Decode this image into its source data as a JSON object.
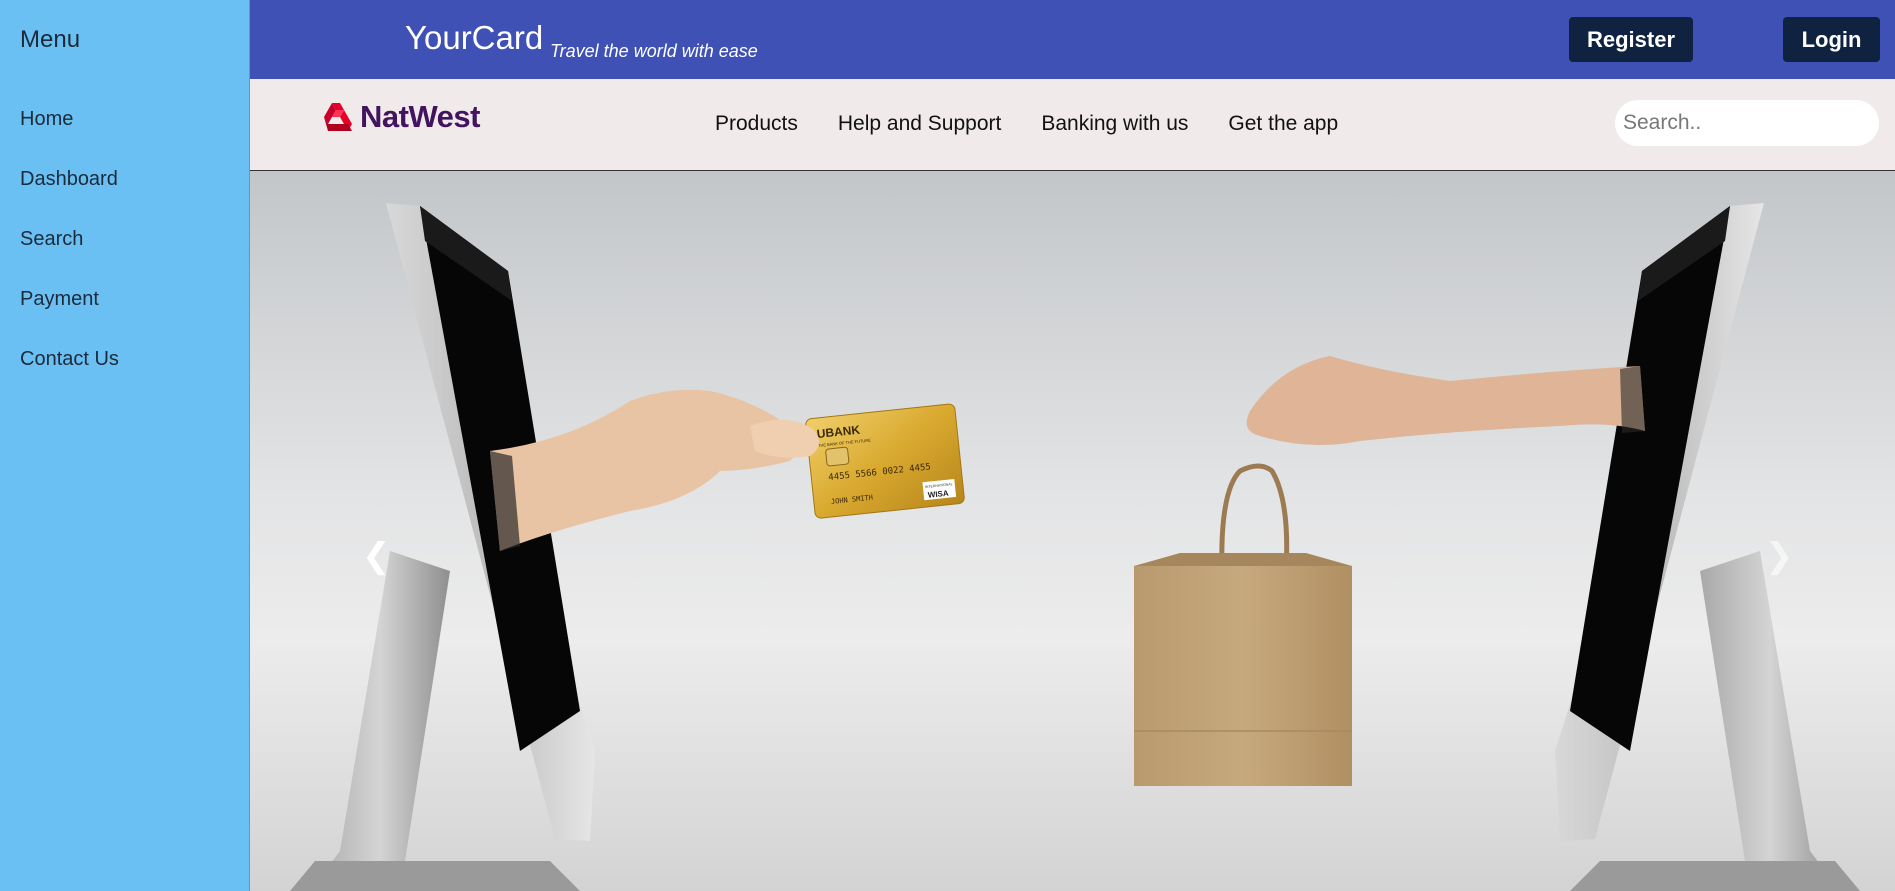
{
  "sidebar": {
    "title": "Menu",
    "items": [
      {
        "label": "Home"
      },
      {
        "label": "Dashboard"
      },
      {
        "label": "Search"
      },
      {
        "label": "Payment"
      },
      {
        "label": "Contact Us"
      }
    ]
  },
  "header": {
    "brand": "YourCard",
    "tagline": "Travel the world with ease",
    "register_label": "Register",
    "login_label": "Login"
  },
  "nav": {
    "logo_text": "NatWest",
    "links": [
      {
        "label": "Products"
      },
      {
        "label": "Help and Support"
      },
      {
        "label": "Banking with us"
      },
      {
        "label": "Get the app"
      }
    ],
    "search_placeholder": "Search.."
  },
  "hero": {
    "card_bank": "UBANK",
    "card_tagline": "THE BANK OF THE FUTURE",
    "card_number": "4455 5566 0022 4455",
    "card_holder": "JOHN SMITH",
    "card_network": "WISA",
    "card_network_label": "INTERNATIONAL",
    "prev_icon": "chevron-left-icon",
    "next_icon": "chevron-right-icon"
  },
  "colors": {
    "sidebar_bg": "#6abff3",
    "topbar_bg": "#3f51b5",
    "button_bg": "#0f2340",
    "navbar_bg": "#f0eaea",
    "logo_red": "#e60028",
    "logo_purple": "#42145f"
  }
}
